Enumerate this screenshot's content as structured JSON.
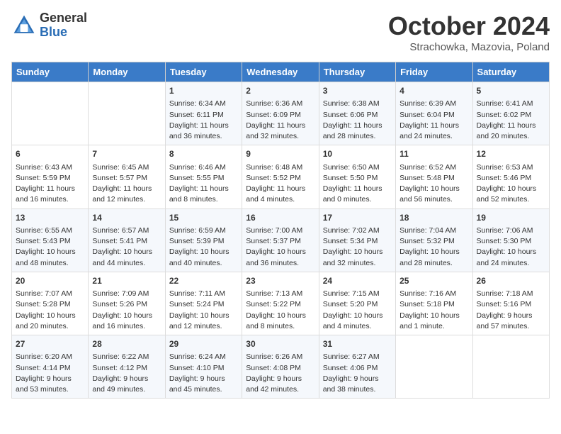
{
  "header": {
    "logo_general": "General",
    "logo_blue": "Blue",
    "month": "October 2024",
    "location": "Strachowka, Mazovia, Poland"
  },
  "weekdays": [
    "Sunday",
    "Monday",
    "Tuesday",
    "Wednesday",
    "Thursday",
    "Friday",
    "Saturday"
  ],
  "weeks": [
    [
      {
        "day": "",
        "info": ""
      },
      {
        "day": "",
        "info": ""
      },
      {
        "day": "1",
        "info": "Sunrise: 6:34 AM\nSunset: 6:11 PM\nDaylight: 11 hours and 36 minutes."
      },
      {
        "day": "2",
        "info": "Sunrise: 6:36 AM\nSunset: 6:09 PM\nDaylight: 11 hours and 32 minutes."
      },
      {
        "day": "3",
        "info": "Sunrise: 6:38 AM\nSunset: 6:06 PM\nDaylight: 11 hours and 28 minutes."
      },
      {
        "day": "4",
        "info": "Sunrise: 6:39 AM\nSunset: 6:04 PM\nDaylight: 11 hours and 24 minutes."
      },
      {
        "day": "5",
        "info": "Sunrise: 6:41 AM\nSunset: 6:02 PM\nDaylight: 11 hours and 20 minutes."
      }
    ],
    [
      {
        "day": "6",
        "info": "Sunrise: 6:43 AM\nSunset: 5:59 PM\nDaylight: 11 hours and 16 minutes."
      },
      {
        "day": "7",
        "info": "Sunrise: 6:45 AM\nSunset: 5:57 PM\nDaylight: 11 hours and 12 minutes."
      },
      {
        "day": "8",
        "info": "Sunrise: 6:46 AM\nSunset: 5:55 PM\nDaylight: 11 hours and 8 minutes."
      },
      {
        "day": "9",
        "info": "Sunrise: 6:48 AM\nSunset: 5:52 PM\nDaylight: 11 hours and 4 minutes."
      },
      {
        "day": "10",
        "info": "Sunrise: 6:50 AM\nSunset: 5:50 PM\nDaylight: 11 hours and 0 minutes."
      },
      {
        "day": "11",
        "info": "Sunrise: 6:52 AM\nSunset: 5:48 PM\nDaylight: 10 hours and 56 minutes."
      },
      {
        "day": "12",
        "info": "Sunrise: 6:53 AM\nSunset: 5:46 PM\nDaylight: 10 hours and 52 minutes."
      }
    ],
    [
      {
        "day": "13",
        "info": "Sunrise: 6:55 AM\nSunset: 5:43 PM\nDaylight: 10 hours and 48 minutes."
      },
      {
        "day": "14",
        "info": "Sunrise: 6:57 AM\nSunset: 5:41 PM\nDaylight: 10 hours and 44 minutes."
      },
      {
        "day": "15",
        "info": "Sunrise: 6:59 AM\nSunset: 5:39 PM\nDaylight: 10 hours and 40 minutes."
      },
      {
        "day": "16",
        "info": "Sunrise: 7:00 AM\nSunset: 5:37 PM\nDaylight: 10 hours and 36 minutes."
      },
      {
        "day": "17",
        "info": "Sunrise: 7:02 AM\nSunset: 5:34 PM\nDaylight: 10 hours and 32 minutes."
      },
      {
        "day": "18",
        "info": "Sunrise: 7:04 AM\nSunset: 5:32 PM\nDaylight: 10 hours and 28 minutes."
      },
      {
        "day": "19",
        "info": "Sunrise: 7:06 AM\nSunset: 5:30 PM\nDaylight: 10 hours and 24 minutes."
      }
    ],
    [
      {
        "day": "20",
        "info": "Sunrise: 7:07 AM\nSunset: 5:28 PM\nDaylight: 10 hours and 20 minutes."
      },
      {
        "day": "21",
        "info": "Sunrise: 7:09 AM\nSunset: 5:26 PM\nDaylight: 10 hours and 16 minutes."
      },
      {
        "day": "22",
        "info": "Sunrise: 7:11 AM\nSunset: 5:24 PM\nDaylight: 10 hours and 12 minutes."
      },
      {
        "day": "23",
        "info": "Sunrise: 7:13 AM\nSunset: 5:22 PM\nDaylight: 10 hours and 8 minutes."
      },
      {
        "day": "24",
        "info": "Sunrise: 7:15 AM\nSunset: 5:20 PM\nDaylight: 10 hours and 4 minutes."
      },
      {
        "day": "25",
        "info": "Sunrise: 7:16 AM\nSunset: 5:18 PM\nDaylight: 10 hours and 1 minute."
      },
      {
        "day": "26",
        "info": "Sunrise: 7:18 AM\nSunset: 5:16 PM\nDaylight: 9 hours and 57 minutes."
      }
    ],
    [
      {
        "day": "27",
        "info": "Sunrise: 6:20 AM\nSunset: 4:14 PM\nDaylight: 9 hours and 53 minutes."
      },
      {
        "day": "28",
        "info": "Sunrise: 6:22 AM\nSunset: 4:12 PM\nDaylight: 9 hours and 49 minutes."
      },
      {
        "day": "29",
        "info": "Sunrise: 6:24 AM\nSunset: 4:10 PM\nDaylight: 9 hours and 45 minutes."
      },
      {
        "day": "30",
        "info": "Sunrise: 6:26 AM\nSunset: 4:08 PM\nDaylight: 9 hours and 42 minutes."
      },
      {
        "day": "31",
        "info": "Sunrise: 6:27 AM\nSunset: 4:06 PM\nDaylight: 9 hours and 38 minutes."
      },
      {
        "day": "",
        "info": ""
      },
      {
        "day": "",
        "info": ""
      }
    ]
  ]
}
